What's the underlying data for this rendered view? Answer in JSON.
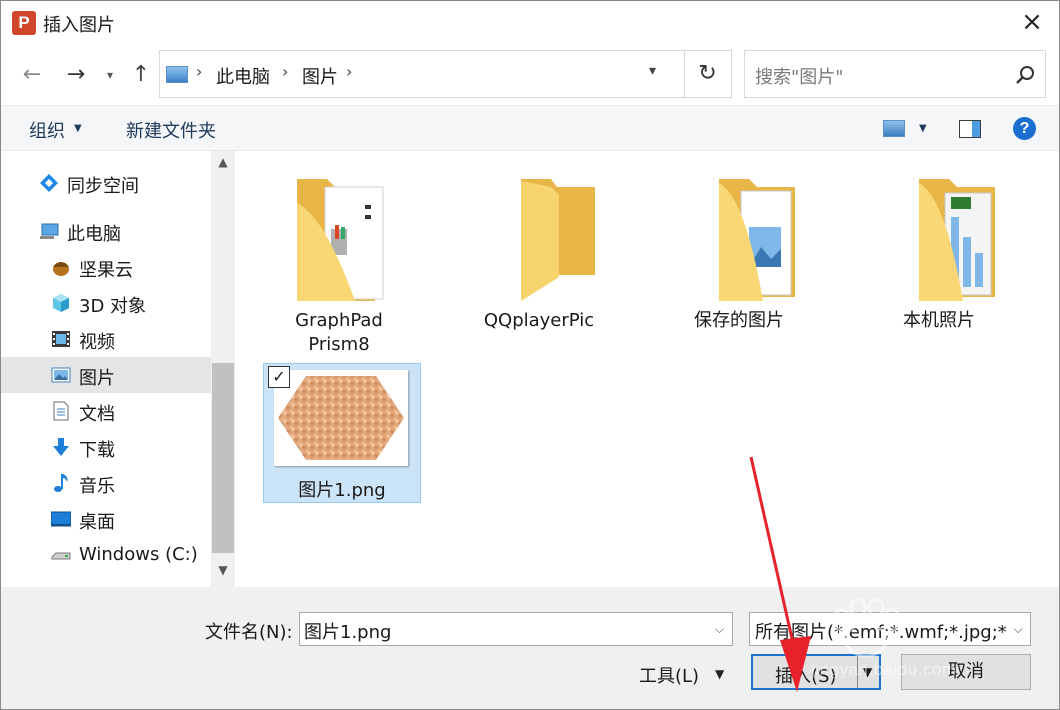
{
  "window": {
    "title": "插入图片",
    "app_icon_letter": "P",
    "colors": {
      "accent": "#1c73cf",
      "selection": "#cce4f7",
      "folder": "#f6d36c",
      "annotation_arrow": "#e8222b"
    }
  },
  "address_bar": {
    "breadcrumbs": [
      "此电脑",
      "图片"
    ],
    "search_placeholder": "搜索\"图片\""
  },
  "toolbar": {
    "organize_label": "组织",
    "new_folder_label": "新建文件夹",
    "help_label": "?"
  },
  "sidebar": {
    "items": [
      {
        "label": "同步空间",
        "icon": "sync-space-icon"
      },
      {
        "label": "此电脑",
        "icon": "this-pc-icon"
      },
      {
        "label": "坚果云",
        "icon": "nutstore-icon"
      },
      {
        "label": "3D 对象",
        "icon": "3d-objects-icon"
      },
      {
        "label": "视频",
        "icon": "videos-icon"
      },
      {
        "label": "图片",
        "icon": "pictures-icon",
        "selected": true
      },
      {
        "label": "文档",
        "icon": "documents-icon"
      },
      {
        "label": "下载",
        "icon": "downloads-icon"
      },
      {
        "label": "音乐",
        "icon": "music-icon"
      },
      {
        "label": "桌面",
        "icon": "desktop-icon"
      },
      {
        "label": "Windows (C:)",
        "icon": "drive-icon"
      }
    ]
  },
  "content": {
    "folders": [
      {
        "label_line1": "GraphPad",
        "label_line2": "Prism8"
      },
      {
        "label_line1": "QQplayerPic",
        "label_line2": ""
      },
      {
        "label_line1": "保存的图片",
        "label_line2": ""
      },
      {
        "label_line1": "本机照片",
        "label_line2": ""
      }
    ],
    "files": [
      {
        "label": "图片1.png",
        "checked": true,
        "check_mark": "✓"
      }
    ]
  },
  "footer": {
    "filename_label": "文件名(N):",
    "filename_value": "图片1.png",
    "filter_value": "所有图片(*.emf;*.wmf;*.jpg;*.jp",
    "tools_label": "工具(L)",
    "insert_label": "插入(S)",
    "cancel_label": "取消"
  },
  "watermark": {
    "text": "jingyan.baidu.com"
  }
}
